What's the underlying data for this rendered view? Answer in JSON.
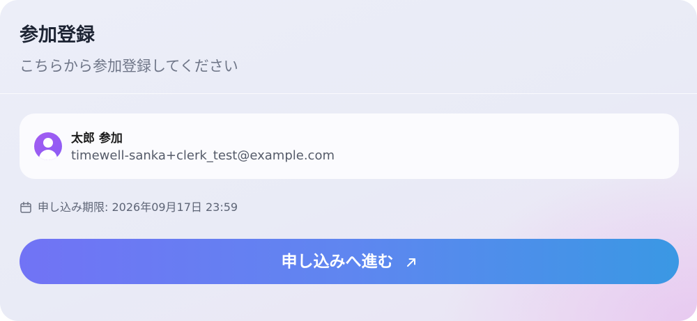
{
  "header": {
    "title": "参加登録",
    "subtitle": "こちらから参加登録してください"
  },
  "user": {
    "name": "太郎 参加",
    "email": "timewell-sanka+clerk_test@example.com",
    "avatar_icon": "user-avatar-icon",
    "avatar_color": "#9b5cf3"
  },
  "deadline": {
    "icon": "calendar-icon",
    "text": "申し込み期限: 2026年09月17日 23:59"
  },
  "apply_button": {
    "label": "申し込みへ進む",
    "icon": "arrow-up-right-icon",
    "gradient_start": "#7173f5",
    "gradient_end": "#3a98e4"
  }
}
